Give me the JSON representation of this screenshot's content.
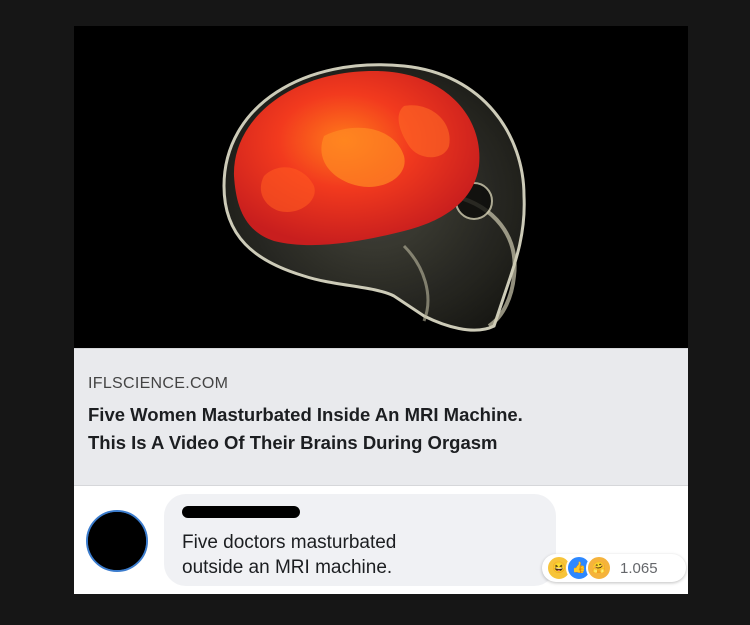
{
  "post": {
    "link_preview": {
      "domain": "IFLSCIENCE.COM",
      "headline_line1": "Five Women Masturbated Inside An MRI Machine.",
      "headline_line2": "This Is A Video Of Their Brains During Orgasm"
    }
  },
  "comment": {
    "text_line1": "Five doctors masturbated",
    "text_line2": "outside an MRI machine.",
    "reactions": {
      "icons": [
        "haha-icon",
        "like-icon",
        "care-icon"
      ],
      "count": "1.065"
    }
  },
  "colors": {
    "background": "#161616",
    "preview_bg": "#e9eaed",
    "bubble_bg": "#f0f1f4",
    "like_blue": "#2d88ff",
    "haha_yellow": "#f7c43a"
  }
}
